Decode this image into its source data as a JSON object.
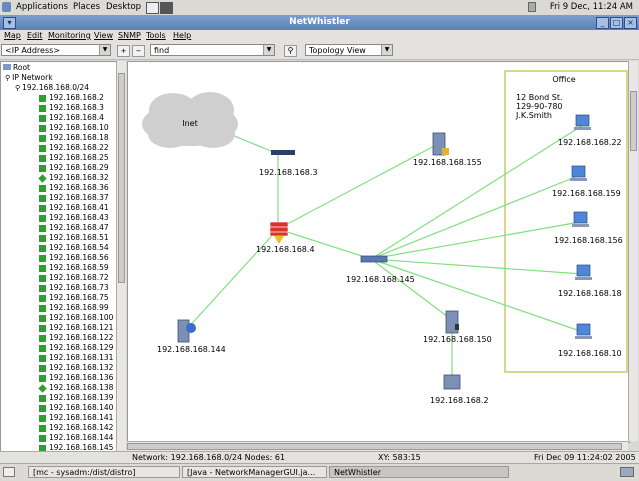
{
  "panel": {
    "menus": [
      "Applications",
      "Places",
      "Desktop"
    ],
    "clock": "Fri  9 Dec, 11:24 AM"
  },
  "window": {
    "title": "NetWhistler"
  },
  "menubar": [
    "Map",
    "Edit",
    "Monitoring",
    "View",
    "SNMP",
    "Tools",
    "Help"
  ],
  "toolbar": {
    "address_combo": "<IP Address>",
    "find_value": "find",
    "view_combo": "Topology View"
  },
  "tree": {
    "root": "Root",
    "ip_network": "IP Network",
    "subnet": "192.168.168.0/24",
    "hosts": [
      "192.168.168.2",
      "192.168.168.3",
      "192.168.168.4",
      "192.168.168.10",
      "192.168.168.18",
      "192.168.168.22",
      "192.168.168.25",
      "192.168.168.29",
      "192.168.168.32",
      "192.168.168.36",
      "192.168.168.37",
      "192.168.168.41",
      "192.168.168.43",
      "192.168.168.47",
      "192.168.168.51",
      "192.168.168.54",
      "192.168.168.56",
      "192.168.168.59",
      "192.168.168.72",
      "192.168.168.73",
      "192.168.168.75",
      "192.168.168.99",
      "192.168.168.100",
      "192.168.168.121",
      "192.168.168.122",
      "192.168.168.129",
      "192.168.168.131",
      "192.168.168.132",
      "192.168.168.136",
      "192.168.168.138",
      "192.168.168.139",
      "192.168.168.140",
      "192.168.168.141",
      "192.168.168.142",
      "192.168.168.144",
      "192.168.168.145"
    ],
    "diamond_hosts": [
      "192.168.168.32",
      "192.168.168.138"
    ]
  },
  "map": {
    "cloud_label": "Inet",
    "office": {
      "title": "Office",
      "address": [
        "12 Bond  St.",
        "129-90-780",
        "J.K.Smith"
      ]
    },
    "nodes": {
      "hub3": "192.168.168.3",
      "firewall": "192.168.168.4",
      "server155": "192.168.168.155",
      "switch145": "192.168.168.145",
      "server144": "192.168.168.144",
      "server150": "192.168.168.150",
      "printer2": "192.168.168.2",
      "pc22": "192.168.168.22",
      "pc159": "192.168.168.159",
      "pc156": "192.168.168.156",
      "pc18": "192.168.168.18",
      "pc10": "192.168.168.10"
    },
    "link_color": "#7fe07f"
  },
  "status": {
    "network": "Network: 192.168.168.0/24 Nodes: 61",
    "xy": "XY: 583:15",
    "time": "Fri Dec 09 11:24:02 2005"
  },
  "taskbar": {
    "items": [
      "[mc - sysadm:/dist/distro]",
      "[Java - NetworkManagerGUI.ja...",
      "NetWhistler"
    ]
  }
}
